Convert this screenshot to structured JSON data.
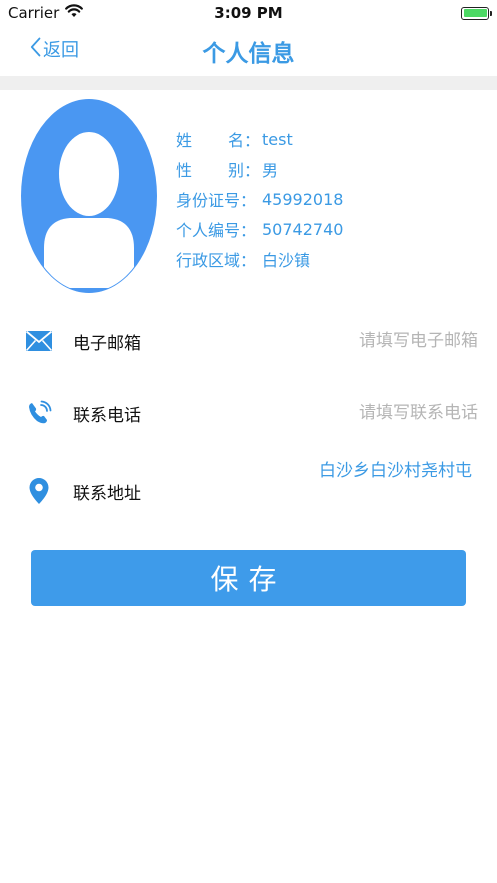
{
  "status_bar": {
    "carrier": "Carrier",
    "time": "3:09 PM",
    "battery_level": 1.0
  },
  "nav": {
    "back_label": "返回",
    "title": "个人信息"
  },
  "profile": {
    "rows": [
      {
        "label_chars": [
          "姓",
          "名"
        ],
        "colon": "：",
        "value": "test"
      },
      {
        "label_chars": [
          "性",
          "别"
        ],
        "colon": "：",
        "value": "男"
      },
      {
        "label_chars": [
          "身份证号"
        ],
        "colon": "：",
        "value": "45992018"
      },
      {
        "label_chars": [
          "个人编号"
        ],
        "colon": "：",
        "value": "50742740"
      },
      {
        "label_chars": [
          "行政区域"
        ],
        "colon": "：",
        "value": "白沙镇"
      }
    ]
  },
  "contact": {
    "email_label": "电子邮箱",
    "email_placeholder": "请填写电子邮箱",
    "phone_label": "联系电话",
    "phone_placeholder": "请填写联系电话",
    "address_label": "联系地址",
    "address_value": "白沙乡白沙村尧村屯"
  },
  "save_label": "保存",
  "colors": {
    "accent": "#3b9ae4",
    "button": "#3e9bea",
    "avatar": "#4a97f2",
    "placeholder": "#b5b5b5"
  }
}
